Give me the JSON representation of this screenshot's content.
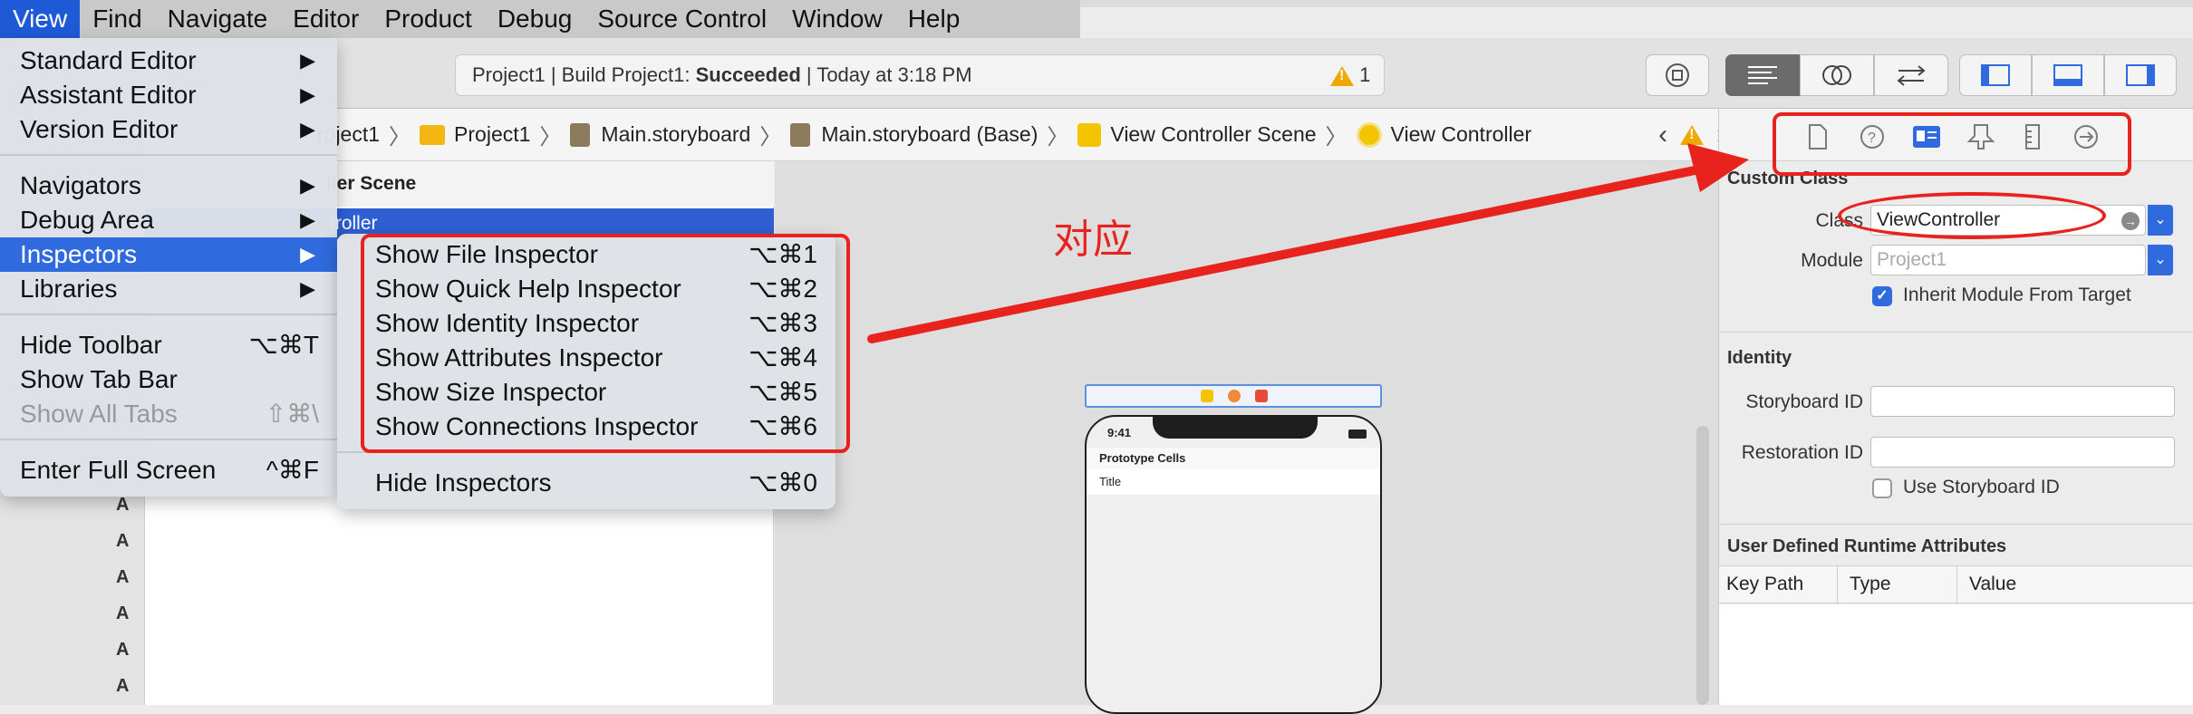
{
  "menubar": {
    "items": [
      "View",
      "Find",
      "Navigate",
      "Editor",
      "Product",
      "Debug",
      "Source Control",
      "Window",
      "Help"
    ]
  },
  "toolbar": {
    "status_prefix": "Project1 | Build Project1: ",
    "status_bold": "Succeeded",
    "status_suffix": " | Today at 3:18 PM",
    "warning_count": "1"
  },
  "jumpbar": {
    "crumbs": [
      "roject1",
      "Project1",
      "Main.storyboard",
      "Main.storyboard (Base)",
      "View Controller Scene",
      "View Controller"
    ]
  },
  "outline": {
    "header": "ller Scene",
    "selected": "troller"
  },
  "gutter_letters": [
    "A",
    "A",
    "A",
    "A",
    "A",
    "A"
  ],
  "canvas": {
    "annotation": "对应",
    "phone_time": "9:41",
    "phone_prototype": "Prototype Cells",
    "phone_title": "Title"
  },
  "view_menu": {
    "items": [
      {
        "label": "Standard Editor",
        "sub": "▶"
      },
      {
        "label": "Assistant Editor",
        "sub": "▶"
      },
      {
        "label": "Version Editor",
        "sub": "▶"
      },
      {
        "label": "Navigators",
        "sub": "▶"
      },
      {
        "label": "Debug Area",
        "sub": "▶"
      },
      {
        "label": "Inspectors",
        "sub": "▶"
      },
      {
        "label": "Libraries",
        "sub": "▶"
      },
      {
        "label": "Hide Toolbar",
        "shortcut": "⌥⌘T"
      },
      {
        "label": "Show Tab Bar",
        "shortcut": ""
      },
      {
        "label": "Show All Tabs",
        "shortcut": "⇧⌘\\"
      },
      {
        "label": "Enter Full Screen",
        "shortcut": "^⌘F"
      }
    ]
  },
  "inspectors_menu": {
    "items": [
      {
        "label": "Show File Inspector",
        "shortcut": "⌥⌘1"
      },
      {
        "label": "Show Quick Help Inspector",
        "shortcut": "⌥⌘2"
      },
      {
        "label": "Show Identity Inspector",
        "shortcut": "⌥⌘3"
      },
      {
        "label": "Show Attributes Inspector",
        "shortcut": "⌥⌘4"
      },
      {
        "label": "Show Size Inspector",
        "shortcut": "⌥⌘5"
      },
      {
        "label": "Show Connections Inspector",
        "shortcut": "⌥⌘6"
      },
      {
        "label": "Hide Inspectors",
        "shortcut": "⌥⌘0"
      }
    ]
  },
  "inspector": {
    "custom_class": {
      "heading": "Custom Class",
      "class_label": "Class",
      "class_value": "ViewController",
      "module_label": "Module",
      "module_placeholder": "Project1",
      "inherit_label": "Inherit Module From Target",
      "inherit_checked": true
    },
    "identity": {
      "heading": "Identity",
      "storyboard_id_label": "Storyboard ID",
      "restoration_id_label": "Restoration ID",
      "use_storyboard_id_label": "Use Storyboard ID",
      "use_storyboard_id_checked": false
    },
    "runtime_attrs": {
      "heading": "User Defined Runtime Attributes",
      "columns": [
        "Key Path",
        "Type",
        "Value"
      ]
    }
  },
  "colors": {
    "accent": "#2f6bde",
    "annotation_red": "#e8231e",
    "warning": "#f0a800"
  }
}
